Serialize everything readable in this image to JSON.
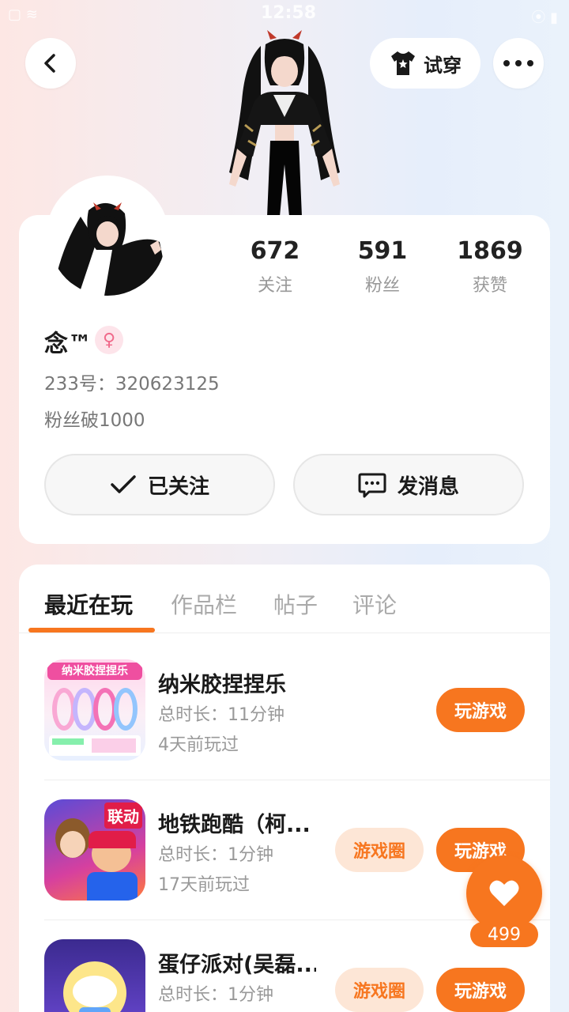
{
  "status_bar": {
    "time": "12:58"
  },
  "header": {
    "tryon_label": "试穿"
  },
  "profile": {
    "stats": [
      {
        "value": "672",
        "label": "关注"
      },
      {
        "value": "591",
        "label": "粉丝"
      },
      {
        "value": "1869",
        "label": "获赞"
      }
    ],
    "username": "念™",
    "gender_symbol": "♀",
    "uid": "233号：320623125",
    "signature": "粉丝破1000",
    "follow_label": "已关注",
    "message_label": "发消息"
  },
  "tabs": [
    {
      "label": "最近在玩"
    },
    {
      "label": "作品栏"
    },
    {
      "label": "帖子"
    },
    {
      "label": "评论"
    }
  ],
  "games": [
    {
      "name": "纳米胶捏捏乐",
      "duration": "总时长：11分钟",
      "last_played": "4天前玩过",
      "play_label": "玩游戏",
      "icon_text": "纳米胶捏捏乐"
    },
    {
      "name": "地铁跑酷（柯...",
      "duration": "总时长：1分钟",
      "last_played": "17天前玩过",
      "circle_label": "游戏圈",
      "play_label": "玩游戏",
      "icon_text": "联动"
    },
    {
      "name": "蛋仔派对(吴磊...",
      "duration": "总时长：1分钟",
      "circle_label": "游戏圈",
      "play_label": "玩游戏"
    }
  ],
  "like": {
    "count": "499"
  },
  "colors": {
    "accent": "#f7761f",
    "accent_light": "#fde6d6"
  }
}
